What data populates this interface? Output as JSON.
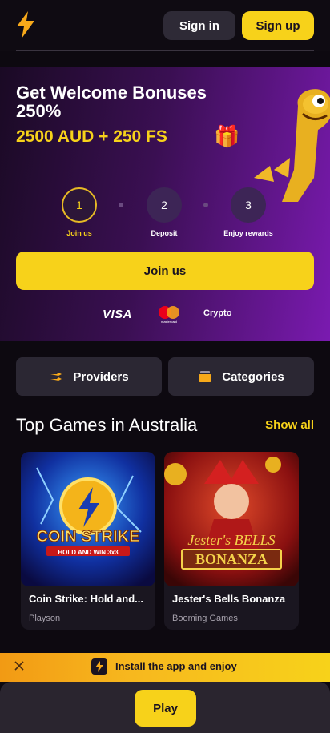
{
  "header": {
    "sign_in_label": "Sign in",
    "sign_up_label": "Sign up",
    "logo_icon": "lightning-bolt-icon"
  },
  "hero": {
    "title": "Get Welcome Bonuses 250%",
    "bonus": "2500 AUD + 250 FS",
    "steps": [
      {
        "number": "1",
        "label": "Join us",
        "active": true
      },
      {
        "number": "2",
        "label": "Deposit",
        "active": false
      },
      {
        "number": "3",
        "label": "Enjoy rewards",
        "active": false
      }
    ],
    "join_label": "Join us",
    "payments": {
      "visa": "VISA",
      "mastercard_text": "mastercard",
      "crypto": "Crypto"
    }
  },
  "categories": {
    "providers_label": "Providers",
    "categories_label": "Categories"
  },
  "top_games": {
    "title": "Top Games in Australia",
    "show_all_label": "Show all",
    "games": [
      {
        "name": "Coin Strike: Hold and...",
        "provider": "Playson",
        "art_title": "COIN STRIKE",
        "art_subtitle": "HOLD AND WIN 3x3"
      },
      {
        "name": "Jester's Bells Bonanza",
        "provider": "Booming Games",
        "art_title": "Jester's BELLS",
        "art_subtitle": "BONANZA"
      }
    ]
  },
  "install_banner": {
    "text": "Install the app and enjoy"
  },
  "bottom_bar": {
    "play_label": "Play"
  },
  "colors": {
    "accent": "#f7d21a",
    "background": "#0d0910",
    "hero_purple": "#7a1ab0",
    "card_bg": "#2b2733"
  }
}
